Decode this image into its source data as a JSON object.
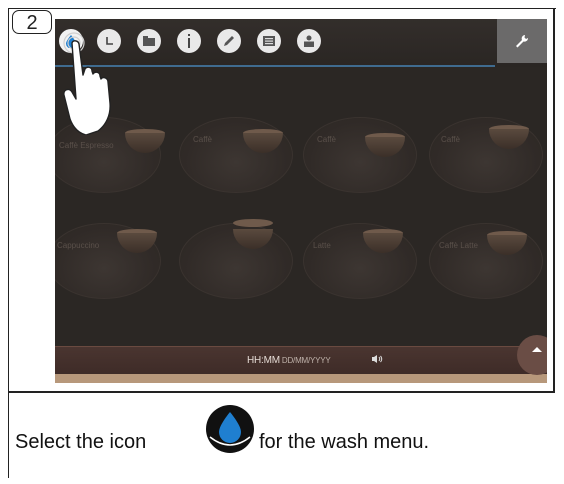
{
  "step_number": "2",
  "toolbar": {
    "icons": [
      "water-drop-icon",
      "clock-icon",
      "folder-icon",
      "info-icon",
      "pencil-icon",
      "list-icon",
      "user-icon"
    ],
    "wrench_icon": "wrench-icon"
  },
  "status_bar": {
    "time": "HH:MM",
    "date": "DD/MM/YYYY",
    "speaker_icon": "speaker-icon",
    "up_icon": "up-arrow-icon"
  },
  "drink_labels": [
    "Caffè Espresso",
    "Caffè",
    "Caffè",
    "Caffè",
    "Cappuccino",
    "",
    "Latte",
    "Caffè Latte"
  ],
  "instruction": {
    "before_icon": "Select the icon",
    "after_icon": "for the wash menu."
  },
  "colors": {
    "screen_bg": "#2b2724",
    "accent_blue": "#1f7fd0",
    "toolbar_line": "#3f6b8f",
    "wrench_button": "#6b6a6a"
  }
}
